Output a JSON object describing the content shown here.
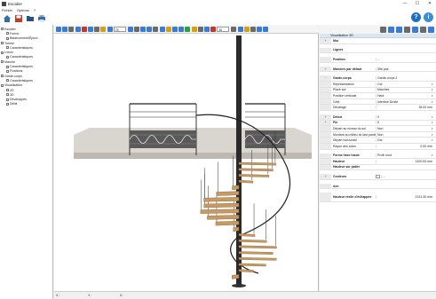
{
  "window": {
    "title": "Escalier",
    "controls": [
      "—",
      "☐",
      "✕"
    ]
  },
  "menu": [
    "Fichier",
    "Options",
    "?"
  ],
  "main_toolbar": {
    "icons": [
      "home-icon",
      "save-icon",
      "open-folder-icon",
      "print-icon"
    ],
    "help_icons": [
      "help-icon",
      "info-icon"
    ]
  },
  "tree": [
    {
      "label": "Escalier",
      "level": 0
    },
    {
      "label": "Forme",
      "level": 1
    },
    {
      "label": "Balancement/Épure",
      "level": 1
    },
    {
      "label": "Trémie",
      "level": 0
    },
    {
      "label": "Caractéristiques",
      "level": 1
    },
    {
      "label": "Limon",
      "level": 0
    },
    {
      "label": "Caractéristiques",
      "level": 1
    },
    {
      "label": "Marche",
      "level": 0
    },
    {
      "label": "Caractéristiques",
      "level": 1
    },
    {
      "label": "Fixations",
      "level": 1
    },
    {
      "label": "Garde-corps",
      "level": 0
    },
    {
      "label": "Caractéristiques",
      "level": 1
    },
    {
      "label": "Visualisation",
      "level": 0
    },
    {
      "label": "2D",
      "level": 1
    },
    {
      "label": "3D",
      "level": 1
    },
    {
      "label": "Développés",
      "level": 1
    },
    {
      "label": "Débit",
      "level": 1
    }
  ],
  "viewport_toolbar": {
    "zoom_value": "75",
    "zoom_value_2": "30"
  },
  "status": [
    "X :",
    "Y :",
    "Z :"
  ],
  "colors": {
    "step_wood": "#c89a63",
    "post_dark": "#2b2b2b",
    "floor_grey": "#d9d6cf",
    "section_header": "#dbe6f2",
    "help_blue": "#1f6fbf",
    "info_blue": "#3a8fd8"
  },
  "properties": {
    "panel_title": "Visualisation 3D",
    "rows": [
      {
        "kind": "header",
        "label": "Visualisation 3D"
      },
      {
        "kind": "row",
        "key": "Mur",
        "value": "",
        "group": "+"
      },
      {
        "kind": "gap"
      },
      {
        "kind": "row",
        "key": "Lignes",
        "value": ""
      },
      {
        "kind": "gap"
      },
      {
        "kind": "row",
        "key": "Position",
        "value": "...",
        "dropdown": false
      },
      {
        "kind": "gap"
      },
      {
        "kind": "row",
        "key": "Marches par défaut",
        "value": "35e pas",
        "group": "+"
      },
      {
        "kind": "gap"
      },
      {
        "kind": "row",
        "key": "Garde-corps",
        "value": "Garde-corps 2",
        "group": "−"
      },
      {
        "kind": "row",
        "key": "Représentation",
        "value": "Oui",
        "sub": true,
        "dropdown": true
      },
      {
        "kind": "row",
        "key": "Placé sur",
        "value": "Marches",
        "sub": true,
        "dropdown": true
      },
      {
        "kind": "row",
        "key": "Position verticale",
        "value": "Haut",
        "sub": true,
        "dropdown": true
      },
      {
        "kind": "row",
        "key": "Côté",
        "value": "Intérieur Droite",
        "sub": true,
        "dropdown": true
      },
      {
        "kind": "row",
        "key": "Décalage",
        "value": "35.00 mm",
        "sub": true,
        "right": true
      },
      {
        "kind": "gap"
      },
      {
        "kind": "row",
        "key": "Début",
        "value": "0",
        "group": "+",
        "dropdown": true
      },
      {
        "kind": "row",
        "key": "Fin",
        "value": "0",
        "group": "+",
        "dropdown": true
      },
      {
        "kind": "row",
        "key": "Départ au niveau du sol",
        "value": "Non",
        "sub": true,
        "dropdown": true
      },
      {
        "kind": "row",
        "key": "Montant au milieu du last panel",
        "value": "Non",
        "sub": true,
        "dropdown": true
      },
      {
        "kind": "row",
        "key": "Départ horizontal",
        "value": "Oui",
        "sub": true,
        "dropdown": true
      },
      {
        "kind": "row",
        "key": "Rayon des coins",
        "value": "0.00 mm",
        "sub": true,
        "right": true
      },
      {
        "kind": "gap"
      },
      {
        "kind": "row",
        "key": "Forme lisse haute",
        "value": "Profil rond",
        "dropdown": true
      },
      {
        "kind": "row",
        "key": "Hauteur",
        "value": "1100.00 mm",
        "right": true
      },
      {
        "kind": "row",
        "key": "Hauteur sur palier",
        "value": "",
        "right": true
      },
      {
        "kind": "gap"
      },
      {
        "kind": "row",
        "key": "Couleurs",
        "value": "...",
        "group": "+",
        "swatch": true
      },
      {
        "kind": "gap"
      },
      {
        "kind": "row",
        "key": "Axe",
        "value": ""
      },
      {
        "kind": "gap"
      },
      {
        "kind": "row",
        "key": "Hauteur réelle d'échappée",
        "value": "2131.30 mm",
        "right": true,
        "tall": true
      }
    ]
  }
}
